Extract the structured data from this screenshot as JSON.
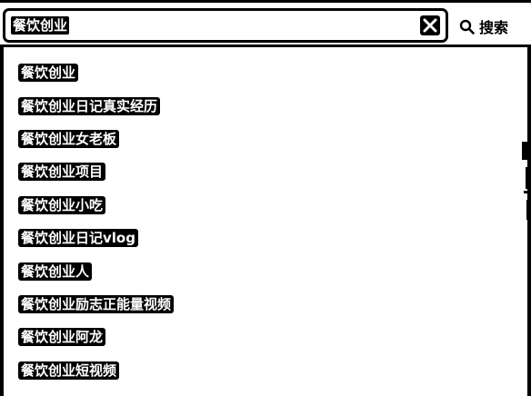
{
  "search": {
    "query": "餐饮创业",
    "button_label": "搜索",
    "clear_icon": "close-icon",
    "search_icon": "search-icon"
  },
  "suggestions": [
    "餐饮创业",
    "餐饮创业日记真实经历",
    "餐饮创业女老板",
    "餐饮创业项目",
    "餐饮创业小吃",
    "餐饮创业日记vlog",
    "餐饮创业人",
    "餐饮创业励志正能量视频",
    "餐饮创业阿龙",
    "餐饮创业短视频"
  ]
}
